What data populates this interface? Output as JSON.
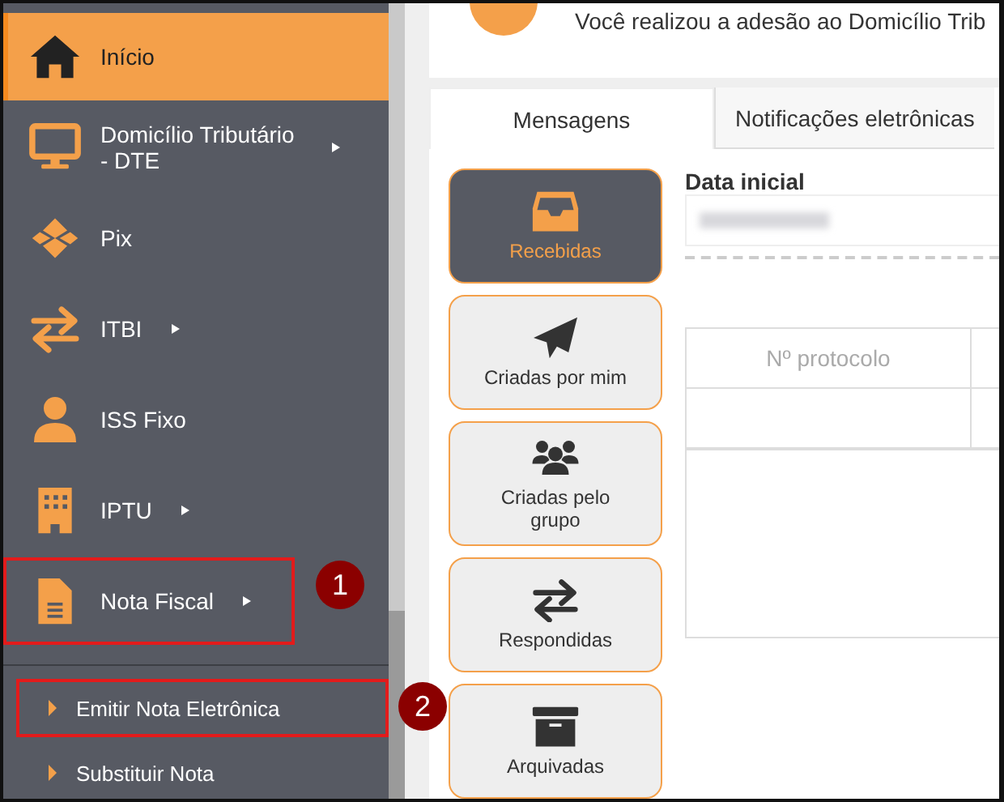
{
  "sidebar": {
    "items": [
      {
        "label": "Início",
        "selected": true,
        "submenu": false
      },
      {
        "label": "Domicílio Tributário - DTE",
        "selected": false,
        "submenu": true
      },
      {
        "label": "Pix",
        "selected": false,
        "submenu": false
      },
      {
        "label": "ITBI",
        "selected": false,
        "submenu": true
      },
      {
        "label": "ISS Fixo",
        "selected": false,
        "submenu": false
      },
      {
        "label": "IPTU",
        "selected": false,
        "submenu": true
      },
      {
        "label": "Nota Fiscal",
        "selected": false,
        "submenu": true,
        "annotation": "1"
      }
    ],
    "subitems": [
      {
        "label": "Emitir Nota Eletrônica",
        "annotation": "2"
      },
      {
        "label": "Substituir Nota"
      }
    ]
  },
  "banner": {
    "text": "Você realizou a adesão ao Domicílio Trib"
  },
  "tabs": [
    {
      "label": "Mensagens",
      "selected": true
    },
    {
      "label": "Notificações eletrônicas",
      "selected": false
    }
  ],
  "folders": [
    {
      "label": "Recebidas",
      "selected": true
    },
    {
      "label": "Criadas por mim",
      "selected": false
    },
    {
      "label": "Criadas pelo grupo",
      "selected": false
    },
    {
      "label": "Respondidas",
      "selected": false
    },
    {
      "label": "Arquivadas",
      "selected": false
    }
  ],
  "filter": {
    "label": "Data inicial"
  },
  "table": {
    "columns": [
      "Nº protocolo"
    ]
  }
}
